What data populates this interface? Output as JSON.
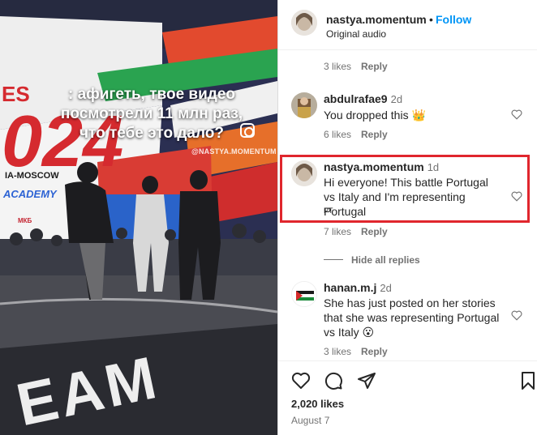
{
  "video": {
    "overlay_caption": ": афигеть, твое видео посмотрели 11 млн раз, что тебе это дало?",
    "watermark": "@NASTYA.MOMENTUM",
    "banner_moscow": "IA-MOSCOW",
    "banner_academy": "ACADEMY",
    "banner_mkb": "МКБ",
    "banner_team": "EAM"
  },
  "header": {
    "username": "nastya.momentum",
    "separator": "•",
    "follow_label": "Follow",
    "audio_label": "Original audio"
  },
  "comments": {
    "top_meta": {
      "likes": "3 likes",
      "reply": "Reply"
    },
    "items": [
      {
        "username": "abdulrafae9",
        "time": "2d",
        "text": "You dropped this 👑",
        "likes": "6 likes",
        "reply": "Reply"
      },
      {
        "username": "nastya.momentum",
        "time": "1d",
        "text": "Hi everyone! This battle Portugal vs Italy and I'm representing Portugal",
        "tag": "PT",
        "likes": "7 likes",
        "reply": "Reply"
      },
      {
        "username": "hanan.m.j",
        "time": "2d",
        "text": "She has just posted on her stories that she was representing Portugal vs Italy 😮",
        "likes": "3 likes",
        "reply": "Reply"
      }
    ],
    "hide_replies_label": "Hide all replies"
  },
  "actions": {
    "likes_count": "2,020 likes",
    "date": "August 7"
  },
  "colors": {
    "accent": "#0095f6",
    "highlight": "#e0262d",
    "muted": "#737373",
    "text": "#262626"
  },
  "icons": [
    "heart-icon",
    "comment-icon",
    "share-icon",
    "bookmark-icon",
    "instagram-icon"
  ]
}
